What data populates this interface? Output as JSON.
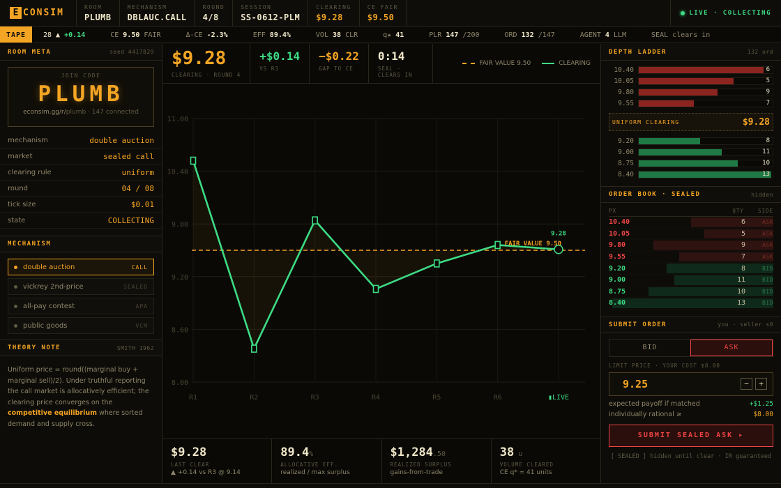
{
  "brand": {
    "letter": "E",
    "name": "CONSIM"
  },
  "topbar": {
    "cells": [
      {
        "k": "ROOM",
        "v": "PLUMB"
      },
      {
        "k": "MECHANISM",
        "v": "DBLAUC.CALL"
      },
      {
        "k": "ROUND",
        "v": "4/8"
      },
      {
        "k": "SESSION",
        "v": "SS-0612-PLM"
      },
      {
        "k": "CLEARING",
        "v": "$9.28"
      },
      {
        "k": "CE FAIR",
        "v": "$9.50"
      }
    ],
    "status": "LIVE · COLLECTING"
  },
  "tape": {
    "label": "TAPE",
    "items": [
      {
        "a": "28 ▲ ",
        "b": "+0.14",
        "c": ""
      },
      {
        "a": "CE ",
        "b": "9.50",
        "c": " FAIR"
      },
      {
        "a": "Δ-CE ",
        "b": "-2.3%",
        "c": ""
      },
      {
        "a": "EFF ",
        "b": "89.4%",
        "c": ""
      },
      {
        "a": "VOL ",
        "b": "38",
        "c": " CLR"
      },
      {
        "a": "q★ ",
        "b": "41",
        "c": ""
      },
      {
        "a": "PLR ",
        "b": "147",
        "c": " /200"
      },
      {
        "a": "ORD ",
        "b": "132",
        "c": " /147"
      },
      {
        "a": "AGENT ",
        "b": "4",
        "c": " LLM"
      },
      {
        "a": "SEAL clears in",
        "b": "",
        "c": ""
      }
    ]
  },
  "left": {
    "room_meta": {
      "title": "ROOM META",
      "seed": "seed 4417829"
    },
    "join": {
      "label": "JOIN CODE",
      "code": "PLUMB",
      "url_host": "econsim.gg/r/",
      "url_rest": "plumb · 147 connected"
    },
    "meta_rows": [
      {
        "k": "mechanism",
        "v": "double auction"
      },
      {
        "k": "market",
        "v": "sealed call"
      },
      {
        "k": "clearing rule",
        "v": "uniform"
      },
      {
        "k": "round",
        "v": "04 / 08"
      },
      {
        "k": "tick size",
        "v": "$0.01"
      },
      {
        "k": "state",
        "v": "COLLECTING"
      }
    ],
    "mechanism": {
      "title": "MECHANISM",
      "items": [
        {
          "name": "double auction",
          "tag": "CALL",
          "selected": true
        },
        {
          "name": "vickrey 2nd-price",
          "tag": "SEALED",
          "selected": false
        },
        {
          "name": "all-pay contest",
          "tag": "APA",
          "selected": false
        },
        {
          "name": "public goods",
          "tag": "VCM",
          "selected": false
        }
      ]
    },
    "theory": {
      "title": "THEORY NOTE",
      "cite": "SMITH 1962",
      "text_a": "Uniform price = round((marginal buy + marginal sell)/2). Under truthful reporting the call market is allocatively efficient; the clearing price converges on the ",
      "text_b": "competitive equilibrium",
      "text_c": " where sorted demand and supply cross."
    }
  },
  "center": {
    "stats": [
      {
        "big": "$9.28",
        "lbl": "CLEARING · ROUND 4"
      },
      {
        "big": "+$0.14",
        "lbl": "VS R3"
      },
      {
        "big": "−$0.22",
        "lbl": "GAP TO CE"
      },
      {
        "big": "0:14",
        "lbl": "SEAL · CLEARS IN"
      }
    ],
    "legend": {
      "fair": "FAIR VALUE 9.50",
      "clearing": "CLEARING"
    },
    "bottom": [
      {
        "v": "$9.28",
        "small": "",
        "l": "LAST CLEAR",
        "s": "▲ +0.14 vs R3 @ 9.14"
      },
      {
        "v": "89.4",
        "small": "%",
        "l": "ALLOCATIVE EFF.",
        "s": "realized / max surplus"
      },
      {
        "v": "$1,284",
        "small": ".50",
        "l": "REALIZED SURPLUS",
        "s": "gains-from-trade"
      },
      {
        "v": "38",
        "small": " u",
        "l": "VOLUME CLEARED",
        "s": "CE q* = 41 units"
      }
    ]
  },
  "chart_data": {
    "type": "line",
    "categories": [
      "R1",
      "R2",
      "R3",
      "R4",
      "R5",
      "R6",
      "▮LIVE"
    ],
    "series": [
      {
        "name": "CLEARING",
        "values": [
          10.52,
          8.38,
          9.84,
          9.06,
          9.35,
          9.56,
          9.51
        ]
      }
    ],
    "fair_value": 9.5,
    "fair_label": "FAIR VALUE 9.50",
    "live_label": "9.28",
    "yticks": [
      "11.00",
      "10.40",
      "9.80",
      "9.20",
      "8.60",
      "8.00"
    ],
    "ylim": [
      8.0,
      11.0
    ],
    "colors": {
      "line": "#3ddc84",
      "fair": "#f5a524"
    }
  },
  "right": {
    "depth": {
      "title": "DEPTH LADDER",
      "sub": "132 ord",
      "asks": [
        {
          "p": "10.40",
          "q": "6",
          "w": 0.93
        },
        {
          "p": "10.05",
          "q": "5",
          "w": 0.71
        },
        {
          "p": "9.80",
          "q": "9",
          "w": 0.59
        },
        {
          "p": "9.55",
          "q": "7",
          "w": 0.41
        }
      ],
      "clear_label": "UNIFORM CLEARING",
      "clear_value": "$9.28",
      "bids": [
        {
          "p": "9.20",
          "q": "8",
          "w": 0.46
        },
        {
          "p": "9.00",
          "q": "11",
          "w": 0.62
        },
        {
          "p": "8.75",
          "q": "10",
          "w": 0.74
        },
        {
          "p": "8.40",
          "q": "13",
          "w": 0.99
        }
      ]
    },
    "orderbook": {
      "title": "ORDER BOOK · SEALED",
      "sub": "hidden",
      "cols": [
        "PX",
        "QTY",
        "SIDE"
      ],
      "rows": [
        {
          "px": "10.40",
          "q": "6",
          "side": "ASK",
          "w": 0.5
        },
        {
          "px": "10.05",
          "q": "5",
          "side": "ASK",
          "w": 0.42
        },
        {
          "px": "9.80",
          "q": "9",
          "side": "ASK",
          "w": 0.73
        },
        {
          "px": "9.55",
          "q": "7",
          "side": "ASK",
          "w": 0.57
        },
        {
          "px": "9.20",
          "q": "8",
          "side": "BID",
          "w": 0.65
        },
        {
          "px": "9.00",
          "q": "11",
          "side": "BID",
          "w": 0.6
        },
        {
          "px": "8.75",
          "q": "10",
          "side": "BID",
          "w": 0.76
        },
        {
          "px": "8.40",
          "q": "13",
          "side": "BID",
          "w": 0.98
        }
      ]
    },
    "submit": {
      "title": "SUBMIT ORDER",
      "sub": "you · seller s0",
      "bid": "BID",
      "ask": "ASK",
      "limit_label": "LIMIT PRICE · YOUR COST $8.00",
      "price": "9.25",
      "minus": "−",
      "plus": "+",
      "payoff_label": "expected payoff if matched",
      "payoff": "+$1.25",
      "ir_label": "individually rational ≥",
      "ir": "$8.00",
      "button": "SUBMIT SEALED ASK ▸",
      "note": "[ SEALED ] hidden until clear · IR guaranteed"
    }
  }
}
